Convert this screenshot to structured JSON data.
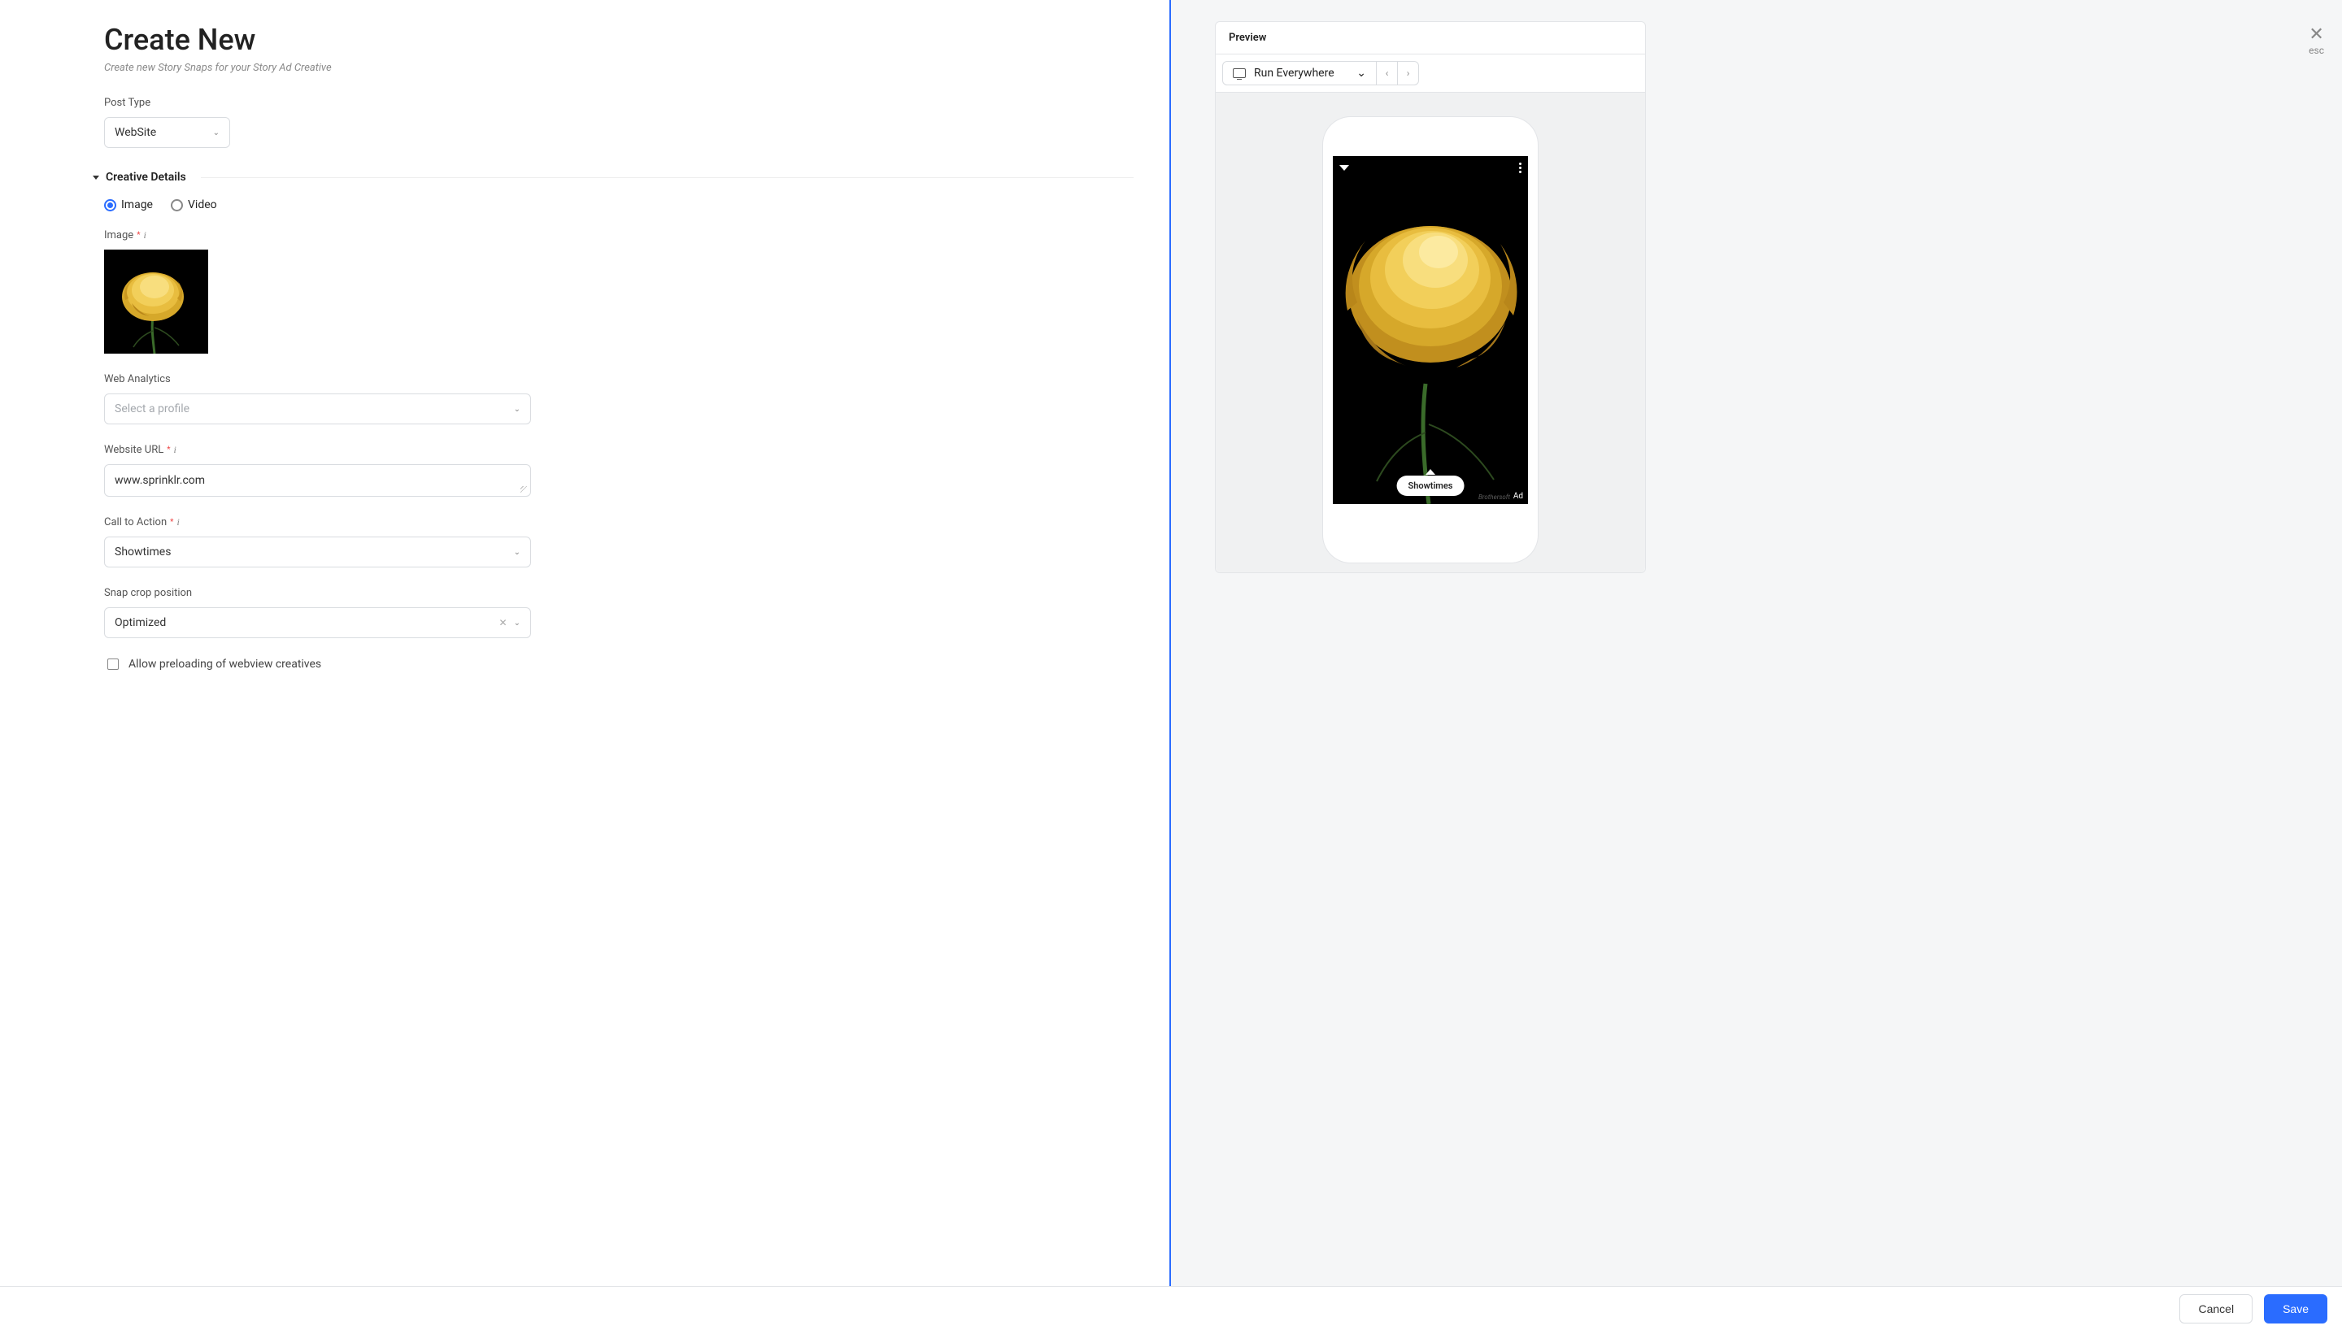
{
  "header": {
    "title": "Create New",
    "subtitle": "Create new Story Snaps for your Story Ad Creative"
  },
  "form": {
    "post_type": {
      "label": "Post Type",
      "value": "WebSite"
    },
    "section_creative_details": "Creative Details",
    "media_type": {
      "options": {
        "image": "Image",
        "video": "Video"
      },
      "selected": "image"
    },
    "image_field": {
      "label": "Image"
    },
    "web_analytics": {
      "label": "Web Analytics",
      "placeholder": "Select a profile"
    },
    "website_url": {
      "label": "Website URL",
      "value": "www.sprinklr.com"
    },
    "cta": {
      "label": "Call to Action",
      "value": "Showtimes"
    },
    "snap_crop": {
      "label": "Snap crop position",
      "value": "Optimized"
    },
    "preload_checkbox": {
      "label": "Allow preloading of webview creatives",
      "checked": false
    }
  },
  "preview": {
    "header": "Preview",
    "device_selector": "Run Everywhere",
    "cta_pill": "Showtimes",
    "ad_tag": "Ad",
    "watermark": "Brothersoft"
  },
  "close": {
    "label": "esc"
  },
  "footer": {
    "cancel": "Cancel",
    "save": "Save"
  },
  "colors": {
    "accent": "#2a6cff"
  }
}
